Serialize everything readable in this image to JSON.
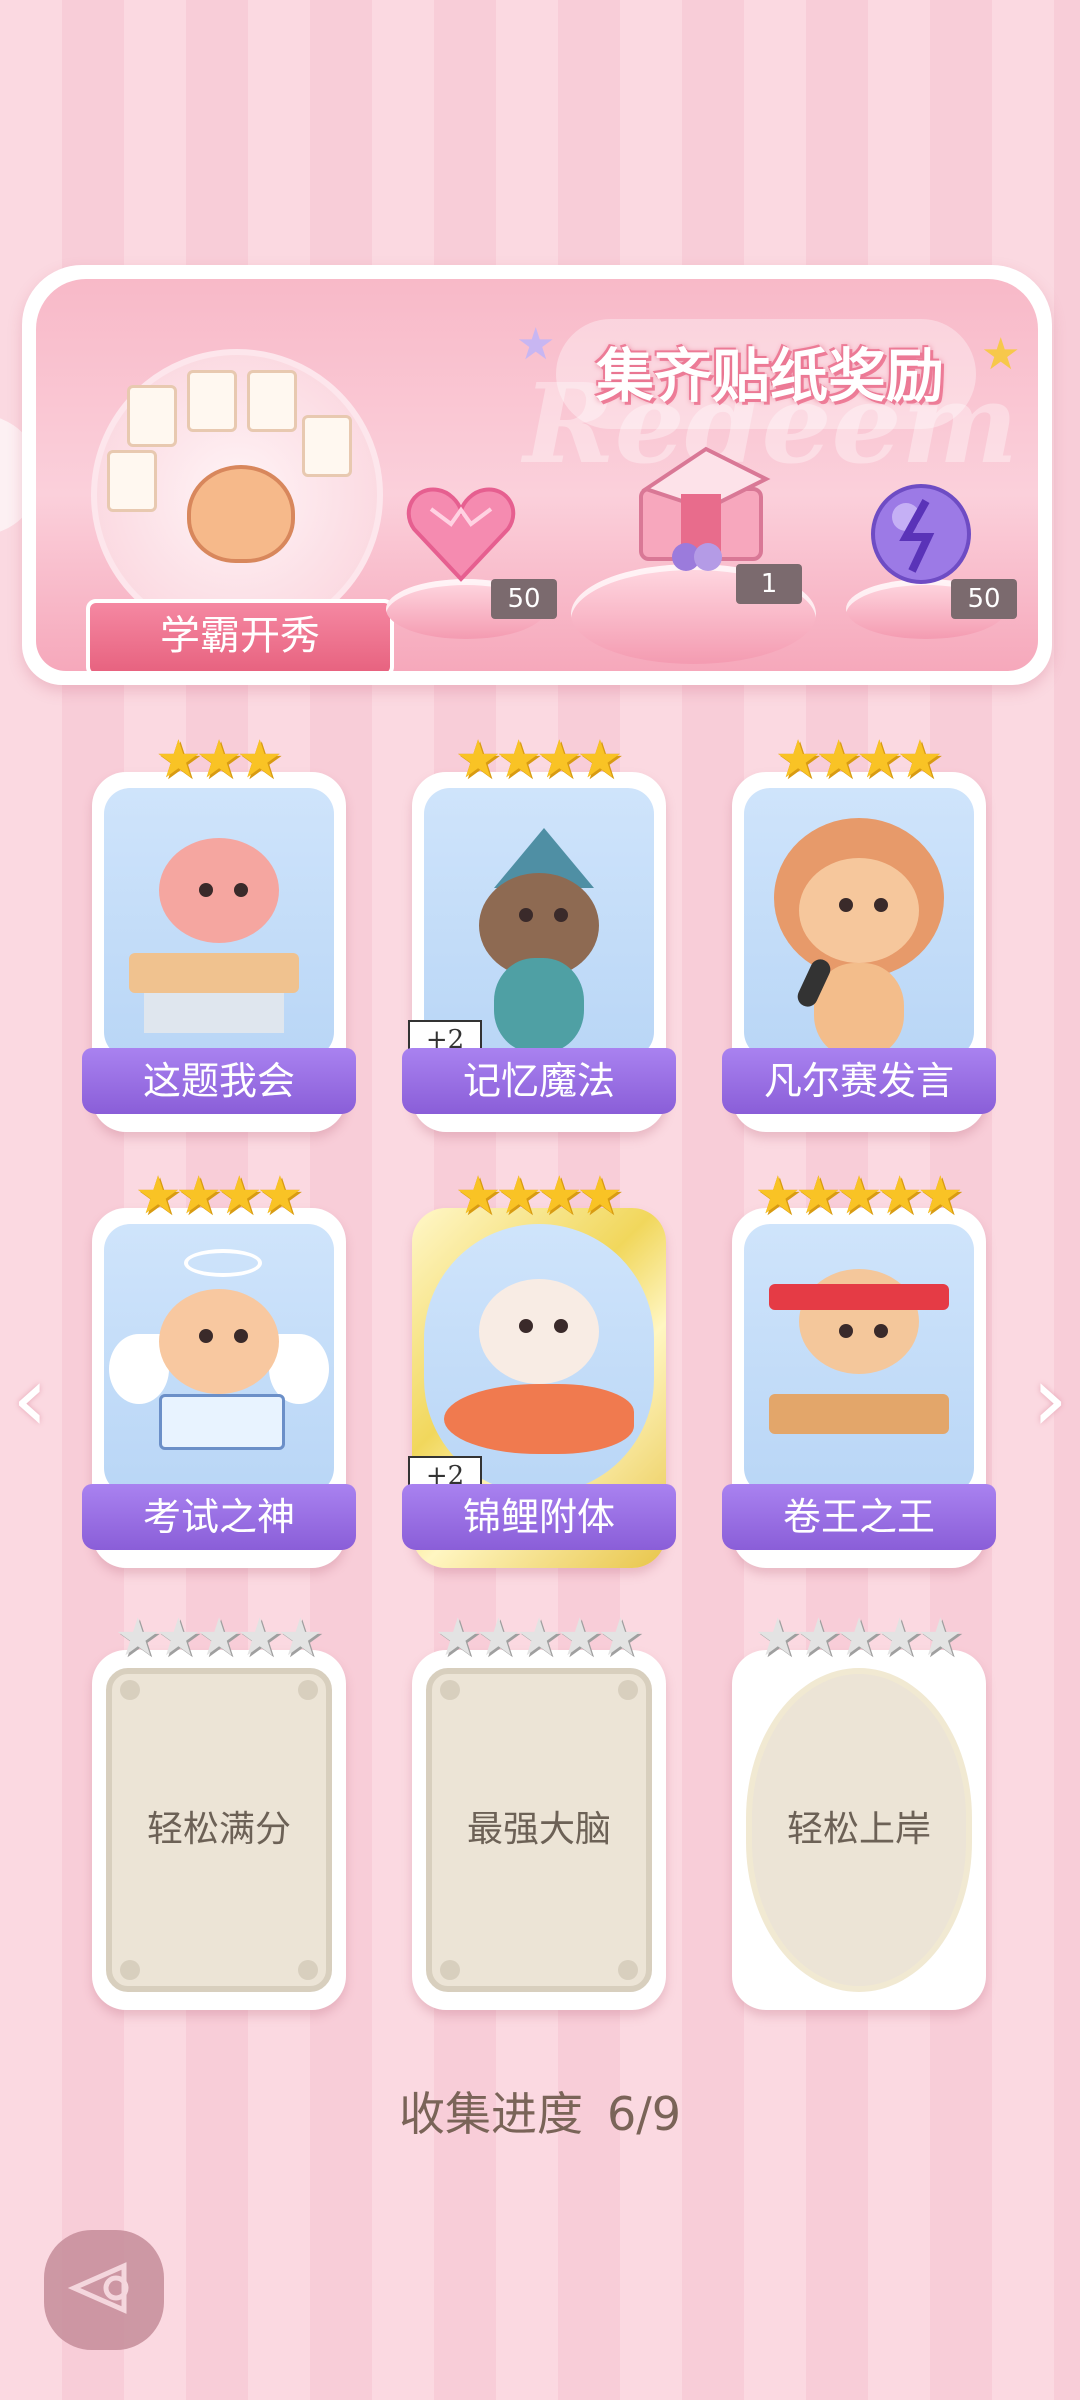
{
  "banner": {
    "title": "集齐贴纸奖励",
    "watermark": "Redeem",
    "hero_label": "学霸开秀",
    "rewards": [
      {
        "icon": "heart-gem-icon",
        "count": "50"
      },
      {
        "icon": "gift-box-icon",
        "count": "1"
      },
      {
        "icon": "energy-orb-icon",
        "count": "50"
      }
    ]
  },
  "cards": [
    {
      "title": "这题我会",
      "stars": 3,
      "collected": true,
      "bonus": "",
      "frame": "normal"
    },
    {
      "title": "记忆魔法",
      "stars": 4,
      "collected": true,
      "bonus": "+2",
      "frame": "normal"
    },
    {
      "title": "凡尔赛发言",
      "stars": 4,
      "collected": true,
      "bonus": "",
      "frame": "normal"
    },
    {
      "title": "考试之神",
      "stars": 4,
      "collected": true,
      "bonus": "",
      "frame": "normal"
    },
    {
      "title": "锦鲤附体",
      "stars": 4,
      "collected": true,
      "bonus": "+2",
      "frame": "gold"
    },
    {
      "title": "卷王之王",
      "stars": 5,
      "collected": true,
      "bonus": "",
      "frame": "normal"
    },
    {
      "title": "轻松满分",
      "stars": 5,
      "collected": false,
      "bonus": "",
      "frame": "normal"
    },
    {
      "title": "最强大脑",
      "stars": 5,
      "collected": false,
      "bonus": "",
      "frame": "normal"
    },
    {
      "title": "轻松上岸",
      "stars": 5,
      "collected": false,
      "bonus": "",
      "frame": "gold"
    }
  ],
  "progress": {
    "label": "收集进度",
    "value": "6/9"
  },
  "nav": {
    "prev": "‹",
    "next": "›"
  },
  "colors": {
    "ribbon": "#8a5ed8",
    "star_gold": "#f9c325",
    "star_grey": "#e3e3e3",
    "background": "#fbd9e1"
  }
}
